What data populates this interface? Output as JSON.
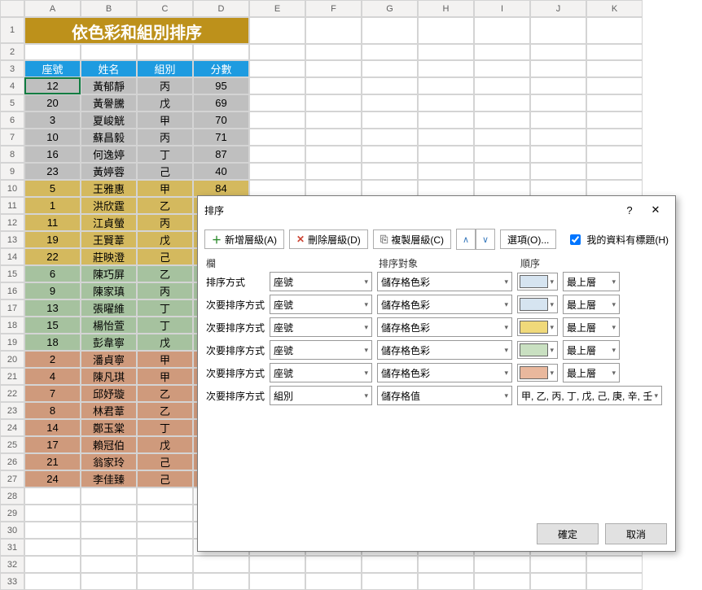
{
  "columns": [
    "A",
    "B",
    "C",
    "D",
    "E",
    "F",
    "G",
    "H",
    "I",
    "J",
    "K"
  ],
  "rowcount": 33,
  "title": "依色彩和組別排序",
  "headers": [
    "座號",
    "姓名",
    "組別",
    "分數"
  ],
  "rows": [
    {
      "g": 1,
      "c": [
        "12",
        "黃郁靜",
        "丙",
        "95"
      ]
    },
    {
      "g": 1,
      "c": [
        "20",
        "黃譽騰",
        "戊",
        "69"
      ]
    },
    {
      "g": 1,
      "c": [
        "3",
        "夏峻觥",
        "甲",
        "70"
      ]
    },
    {
      "g": 1,
      "c": [
        "10",
        "蘇昌毅",
        "丙",
        "71"
      ]
    },
    {
      "g": 1,
      "c": [
        "16",
        "何逸婷",
        "丁",
        "87"
      ]
    },
    {
      "g": 1,
      "c": [
        "23",
        "黃婷蓉",
        "己",
        "40"
      ]
    },
    {
      "g": 2,
      "c": [
        "5",
        "王雅惠",
        "甲",
        "84"
      ]
    },
    {
      "g": 2,
      "c": [
        "1",
        "洪欣霆",
        "乙",
        ""
      ]
    },
    {
      "g": 2,
      "c": [
        "11",
        "江貞螢",
        "丙",
        ""
      ]
    },
    {
      "g": 2,
      "c": [
        "19",
        "王賢葦",
        "戊",
        ""
      ]
    },
    {
      "g": 2,
      "c": [
        "22",
        "莊映澄",
        "己",
        ""
      ]
    },
    {
      "g": 3,
      "c": [
        "6",
        "陳巧屏",
        "乙",
        ""
      ]
    },
    {
      "g": 3,
      "c": [
        "9",
        "陳家瑱",
        "丙",
        ""
      ]
    },
    {
      "g": 3,
      "c": [
        "13",
        "張曜維",
        "丁",
        ""
      ]
    },
    {
      "g": 3,
      "c": [
        "15",
        "楊怡萱",
        "丁",
        ""
      ]
    },
    {
      "g": 3,
      "c": [
        "18",
        "彭韋寧",
        "戊",
        ""
      ]
    },
    {
      "g": 4,
      "c": [
        "2",
        "潘貞寧",
        "甲",
        ""
      ]
    },
    {
      "g": 4,
      "c": [
        "4",
        "陳凡琪",
        "甲",
        ""
      ]
    },
    {
      "g": 4,
      "c": [
        "7",
        "邱妤璇",
        "乙",
        ""
      ]
    },
    {
      "g": 4,
      "c": [
        "8",
        "林君葦",
        "乙",
        ""
      ]
    },
    {
      "g": 4,
      "c": [
        "14",
        "鄭玉棠",
        "丁",
        ""
      ]
    },
    {
      "g": 4,
      "c": [
        "17",
        "賴冠伯",
        "戊",
        ""
      ]
    },
    {
      "g": 4,
      "c": [
        "21",
        "翁家玲",
        "己",
        ""
      ]
    },
    {
      "g": 4,
      "c": [
        "24",
        "李佳臻",
        "己",
        ""
      ]
    }
  ],
  "dlg": {
    "title": "排序",
    "add": "新增層級(A)",
    "del": "刪除層級(D)",
    "copy": "複製層級(C)",
    "opts": "選項(O)...",
    "chk": "我的資料有標題(H)",
    "h1": "欄",
    "h2": "排序對象",
    "h3": "順序",
    "topmost": "最上層",
    "seat": "座號",
    "group": "組別",
    "cellcolor": "儲存格色彩",
    "cellval": "儲存格值",
    "ordstr": "甲, 乙, 丙, 丁, 戊, 己, 庚, 辛, 壬",
    "lbl1": "排序方式",
    "lbl2": "次要排序方式",
    "ok": "確定",
    "cancel": "取消",
    "swatches": [
      "#d6e4f0",
      "#d6e4f0",
      "#f0d97a",
      "#c9e0c1",
      "#e9b89d"
    ]
  }
}
